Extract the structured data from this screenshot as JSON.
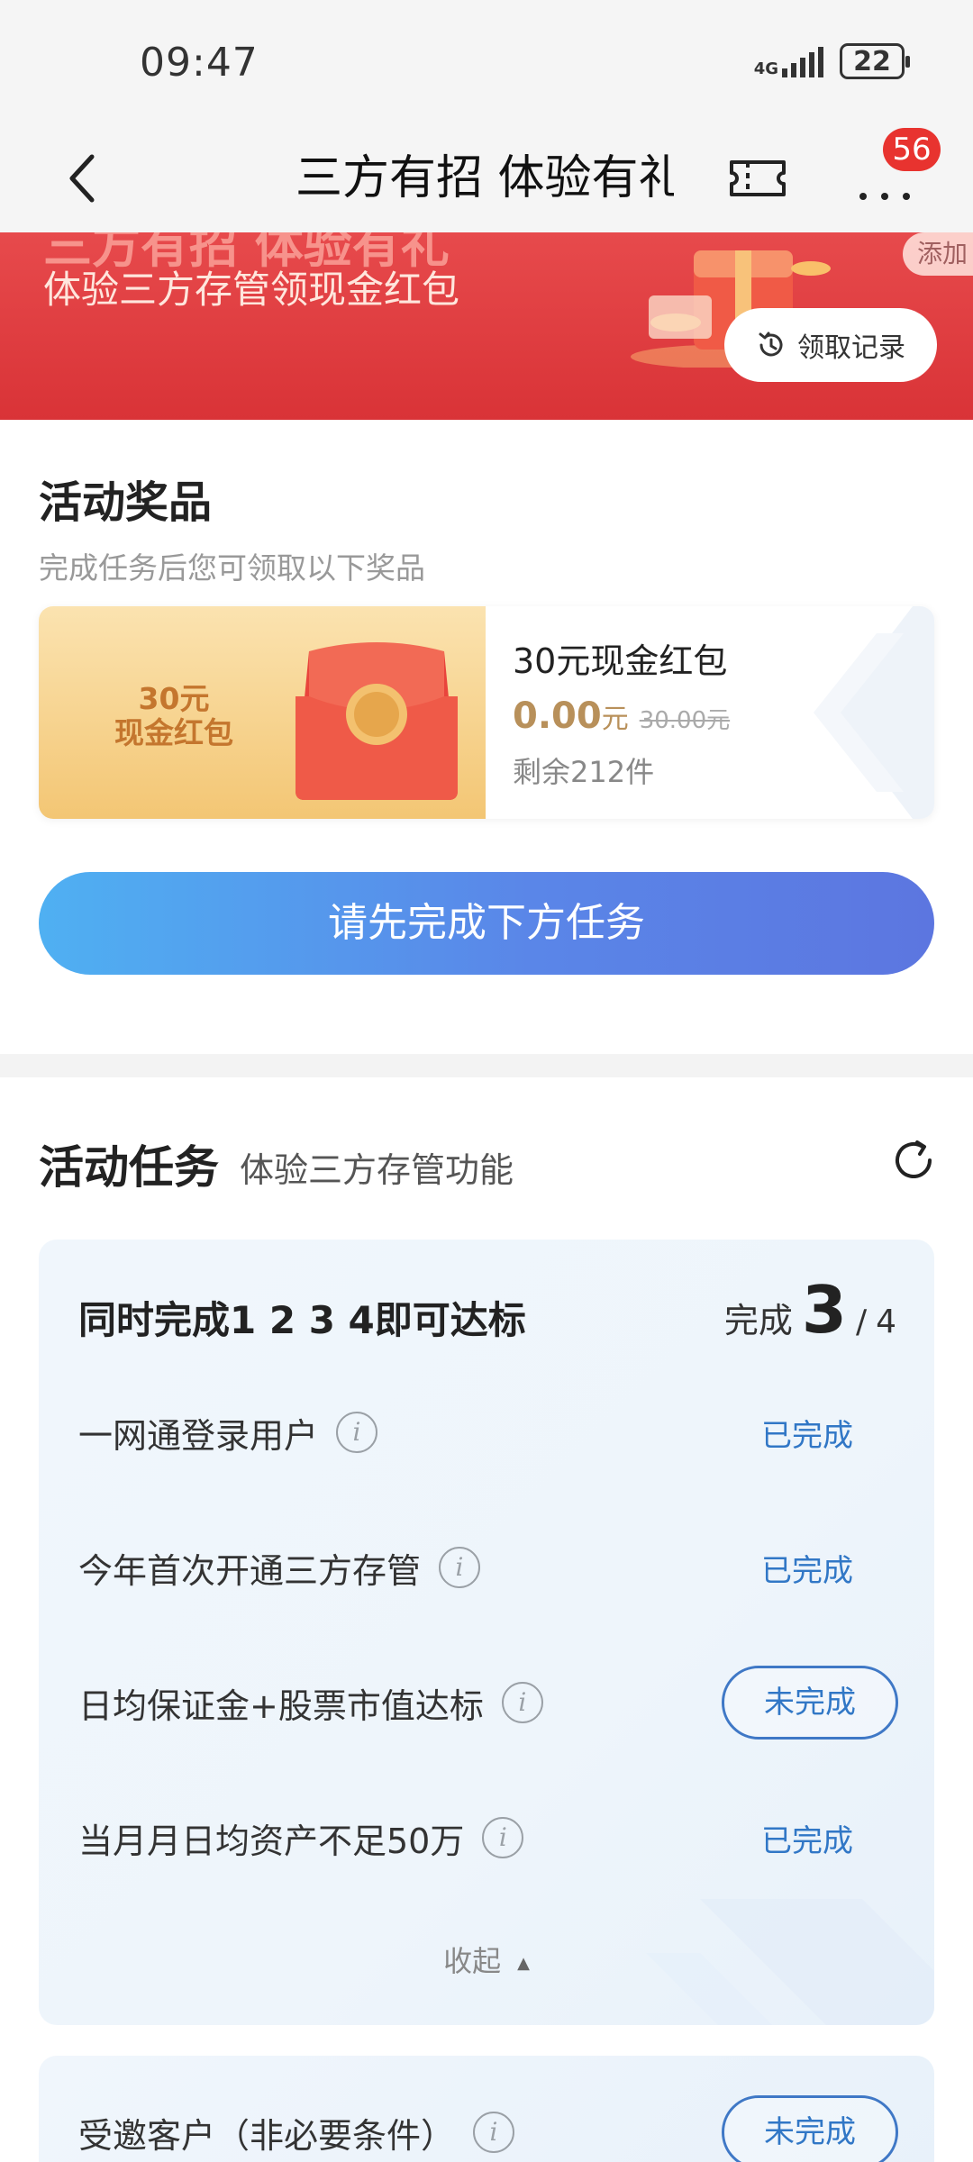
{
  "status_bar": {
    "time": "09:47",
    "network": "4G",
    "battery": "22"
  },
  "nav": {
    "title": "三方有招 体验有礼",
    "badge": "56"
  },
  "banner": {
    "ghost_title": "三方有招 体验有礼",
    "subtitle": "体验三方存管领现金红包",
    "add_label": "添加",
    "record_label": "领取记录"
  },
  "prize_section": {
    "title": "活动奖品",
    "subtitle": "完成任务后您可领取以下奖品",
    "card": {
      "image_text_line1": "30元",
      "image_text_line2": "现金红包",
      "name": "30元现金红包",
      "price": "0.00",
      "price_unit": "元",
      "original_price": "30.00元",
      "stock": "剩余212件"
    },
    "cta_label": "请先完成下方任务"
  },
  "task_section": {
    "title": "活动任务",
    "subtitle": "体验三方存管功能",
    "card": {
      "heading": "同时完成1 2 3 4即可达标",
      "progress_label": "完成",
      "progress_done": "3",
      "progress_sep": "/",
      "progress_total": "4",
      "tasks": [
        {
          "name": "一网通登录用户",
          "status": "已完成"
        },
        {
          "name": "今年首次开通三方存管",
          "status": "已完成"
        },
        {
          "name": "日均保证金+股票市值达标",
          "status": "未完成"
        },
        {
          "name": "当月月日均资产不足50万",
          "status": "已完成"
        }
      ],
      "collapse_label": "收起"
    },
    "invite": {
      "name": "受邀客户（非必要条件）",
      "status": "未完成"
    }
  },
  "colors": {
    "accent_blue": "#3177c6",
    "banner_red": "#d93337",
    "badge_red": "#e8332f",
    "price_gold": "#b8905a"
  },
  "icons": [
    "back-icon",
    "ticket-icon",
    "more-icon",
    "history-icon",
    "refresh-icon",
    "info-icon"
  ]
}
